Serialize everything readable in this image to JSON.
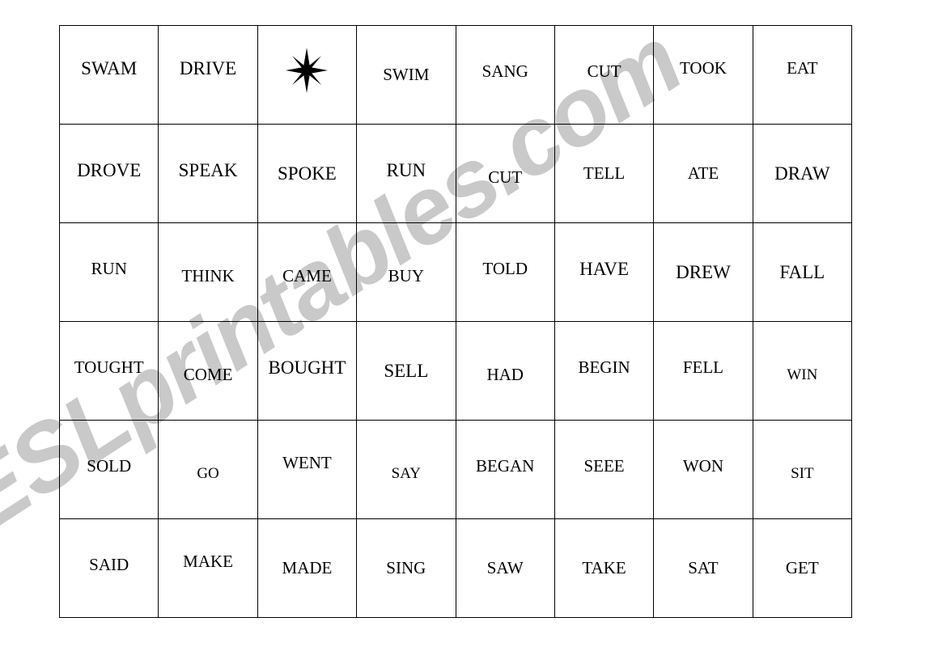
{
  "page": {
    "background_color": "#ffffff",
    "border_color": "#000000"
  },
  "watermark": {
    "text": "ESLprintables.com",
    "color": "#c9c9c9",
    "rotation_deg": -33
  },
  "grid": {
    "columns": 8,
    "rows": 6,
    "free_space_icon": "compass-rose-icon",
    "cells": [
      [
        {
          "text": "SWAM",
          "size": "sz-lg",
          "shift": "up-2"
        },
        {
          "text": "DRIVE",
          "size": "sz-lg",
          "shift": "up-2"
        },
        {
          "text": "",
          "size": "sz-lg",
          "shift": "up-2",
          "icon": "compass-rose-icon"
        },
        {
          "text": "SWIM",
          "size": "sz-md",
          "shift": "nudge-0"
        },
        {
          "text": "SANG",
          "size": "sz-md",
          "shift": "up-1"
        },
        {
          "text": "CUT",
          "size": "sz-md",
          "shift": "up-1"
        },
        {
          "text": "TOOK",
          "size": "sz-md",
          "shift": "up-2"
        },
        {
          "text": "EAT",
          "size": "sz-md",
          "shift": "up-2"
        }
      ],
      [
        {
          "text": "DROVE",
          "size": "sz-lg",
          "shift": "up-1"
        },
        {
          "text": "SPEAK",
          "size": "sz-lg",
          "shift": "up-1"
        },
        {
          "text": "SPOKE",
          "size": "sz-lg",
          "shift": "nudge-0"
        },
        {
          "text": "RUN",
          "size": "sz-lg",
          "shift": "up-1"
        },
        {
          "text": "CUT",
          "size": "sz-md",
          "shift": "dn-1"
        },
        {
          "text": "TELL",
          "size": "sz-md",
          "shift": "nudge-0"
        },
        {
          "text": "ATE",
          "size": "sz-md",
          "shift": "nudge-0"
        },
        {
          "text": "DRAW",
          "size": "sz-lg",
          "shift": "nudge-0"
        }
      ],
      [
        {
          "text": "RUN",
          "size": "sz-md",
          "shift": "up-1"
        },
        {
          "text": "THINK",
          "size": "sz-md",
          "shift": "dn-1"
        },
        {
          "text": "CAME",
          "size": "sz-md",
          "shift": "dn-1"
        },
        {
          "text": "BUY",
          "size": "sz-md",
          "shift": "dn-1"
        },
        {
          "text": "TOLD",
          "size": "sz-md",
          "shift": "up-1"
        },
        {
          "text": "HAVE",
          "size": "sz-lg",
          "shift": "up-1"
        },
        {
          "text": "DREW",
          "size": "sz-lg",
          "shift": "nudge-0"
        },
        {
          "text": "FALL",
          "size": "sz-lg",
          "shift": "nudge-0"
        }
      ],
      [
        {
          "text": "TOUGHT",
          "size": "sz-md",
          "shift": "up-1"
        },
        {
          "text": "COME",
          "size": "sz-md",
          "shift": "dn-1"
        },
        {
          "text": "BOUGHT",
          "size": "sz-lg",
          "shift": "up-1"
        },
        {
          "text": "SELL",
          "size": "sz-lg",
          "shift": "nudge-0"
        },
        {
          "text": "HAD",
          "size": "sz-md",
          "shift": "dn-1"
        },
        {
          "text": "BEGIN",
          "size": "sz-md",
          "shift": "up-1"
        },
        {
          "text": "FELL",
          "size": "sz-md",
          "shift": "up-1"
        },
        {
          "text": "WIN",
          "size": "sz-sm",
          "shift": "dn-1"
        }
      ],
      [
        {
          "text": "SOLD",
          "size": "sz-md",
          "shift": "up-1"
        },
        {
          "text": "GO",
          "size": "sz-sm",
          "shift": "dn-1"
        },
        {
          "text": "WENT",
          "size": "sz-md",
          "shift": "up-2"
        },
        {
          "text": "SAY",
          "size": "sz-sm",
          "shift": "dn-1"
        },
        {
          "text": "BEGAN",
          "size": "sz-md",
          "shift": "up-1"
        },
        {
          "text": "SEEE",
          "size": "sz-md",
          "shift": "up-1"
        },
        {
          "text": "WON",
          "size": "sz-md",
          "shift": "up-1"
        },
        {
          "text": "SIT",
          "size": "sz-sm",
          "shift": "dn-1"
        }
      ],
      [
        {
          "text": "SAID",
          "size": "sz-md",
          "shift": "up-1"
        },
        {
          "text": "MAKE",
          "size": "sz-md",
          "shift": "up-2"
        },
        {
          "text": "MADE",
          "size": "sz-md",
          "shift": "nudge-0"
        },
        {
          "text": "SING",
          "size": "sz-md",
          "shift": "nudge-0"
        },
        {
          "text": "SAW",
          "size": "sz-md",
          "shift": "nudge-0"
        },
        {
          "text": "TAKE",
          "size": "sz-md",
          "shift": "nudge-0"
        },
        {
          "text": "SAT",
          "size": "sz-md",
          "shift": "nudge-0"
        },
        {
          "text": "GET",
          "size": "sz-md",
          "shift": "nudge-0"
        }
      ]
    ]
  }
}
